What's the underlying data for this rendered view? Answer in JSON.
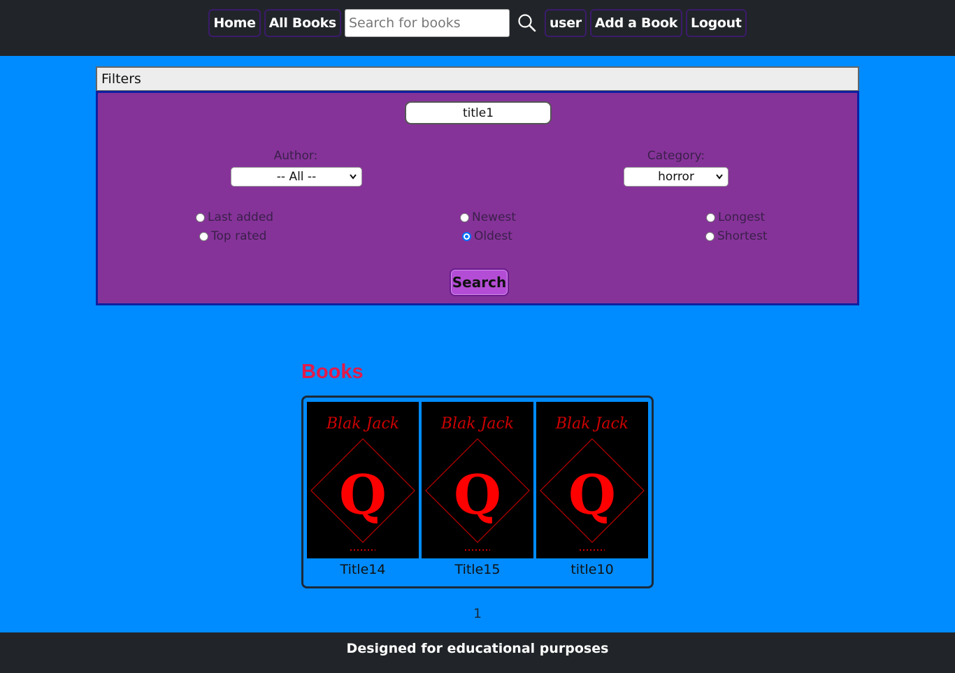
{
  "nav": {
    "home": "Home",
    "all_books": "All Books",
    "search_placeholder": "Search for books",
    "user": "user",
    "add_book": "Add a Book",
    "logout": "Logout"
  },
  "filters": {
    "header": "Filters",
    "title_value": "title1",
    "author_label": "Author:",
    "author_selected": "-- All --",
    "category_label": "Category:",
    "category_selected": "horror",
    "sort_options": {
      "last_added": "Last added",
      "top_rated": "Top rated",
      "newest": "Newest",
      "oldest": "Oldest",
      "longest": "Longest",
      "shortest": "Shortest"
    },
    "selected_sort": "oldest",
    "search_button": "Search"
  },
  "books": {
    "heading": "Books",
    "cover_text": "Blak Jack",
    "cover_letter": "Q",
    "items": [
      {
        "title": "Title14"
      },
      {
        "title": "Title15"
      },
      {
        "title": "title10"
      }
    ]
  },
  "pagination": {
    "current": "1"
  },
  "footer": {
    "text": "Designed for educational purposes"
  },
  "colors": {
    "background": "#008cff",
    "navbar": "#212529",
    "filter_panel": "#863399",
    "books_heading": "#e31a4a",
    "cover_accent": "#ff0000"
  }
}
